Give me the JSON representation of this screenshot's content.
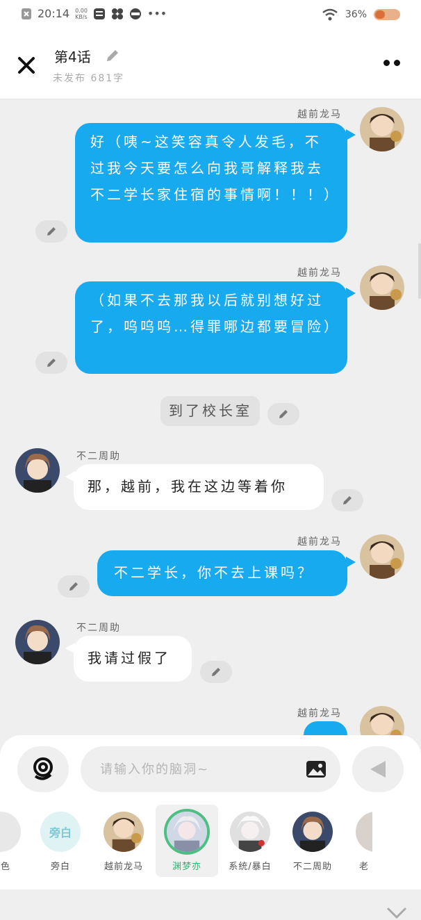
{
  "status": {
    "time": "20:14",
    "speed_top": "0.00",
    "speed_bottom": "KB/s",
    "battery": "36%"
  },
  "header": {
    "title": "第4话",
    "subtitle": "未发布 681字"
  },
  "messages": [
    {
      "type": "right",
      "name": "越前龙马",
      "text": "好（咦~这笑容真令人发毛，不过我今天要怎么向我哥解释我去不二学长家住宿的事情啊！！！）"
    },
    {
      "type": "right",
      "name": "越前龙马",
      "text": "（如果不去那我以后就别想好过了，呜呜呜…得罪哪边都要冒险）"
    },
    {
      "type": "narration",
      "text": "到了校长室"
    },
    {
      "type": "left",
      "name": "不二周助",
      "text": "那，越前，我在这边等着你"
    },
    {
      "type": "right",
      "name": "越前龙马",
      "text": "不二学长，你不去上课吗？"
    },
    {
      "type": "left",
      "name": "不二周助",
      "text": "我请过假了"
    },
    {
      "type": "right",
      "name": "越前龙马",
      "text": ""
    }
  ],
  "composer": {
    "placeholder": "请输入你的脑洞~"
  },
  "roles": [
    {
      "label": "角色",
      "avatar": "partial-icon"
    },
    {
      "label": "旁白",
      "badge": "旁白"
    },
    {
      "label": "越前龙马"
    },
    {
      "label": "渊梦亦",
      "selected": true
    },
    {
      "label": "系统/暴白"
    },
    {
      "label": "不二周助"
    },
    {
      "label": "老"
    }
  ],
  "colors": {
    "bubble_blue": "#18aaee",
    "selected_green": "#4dbf83",
    "background": "#efefef"
  }
}
